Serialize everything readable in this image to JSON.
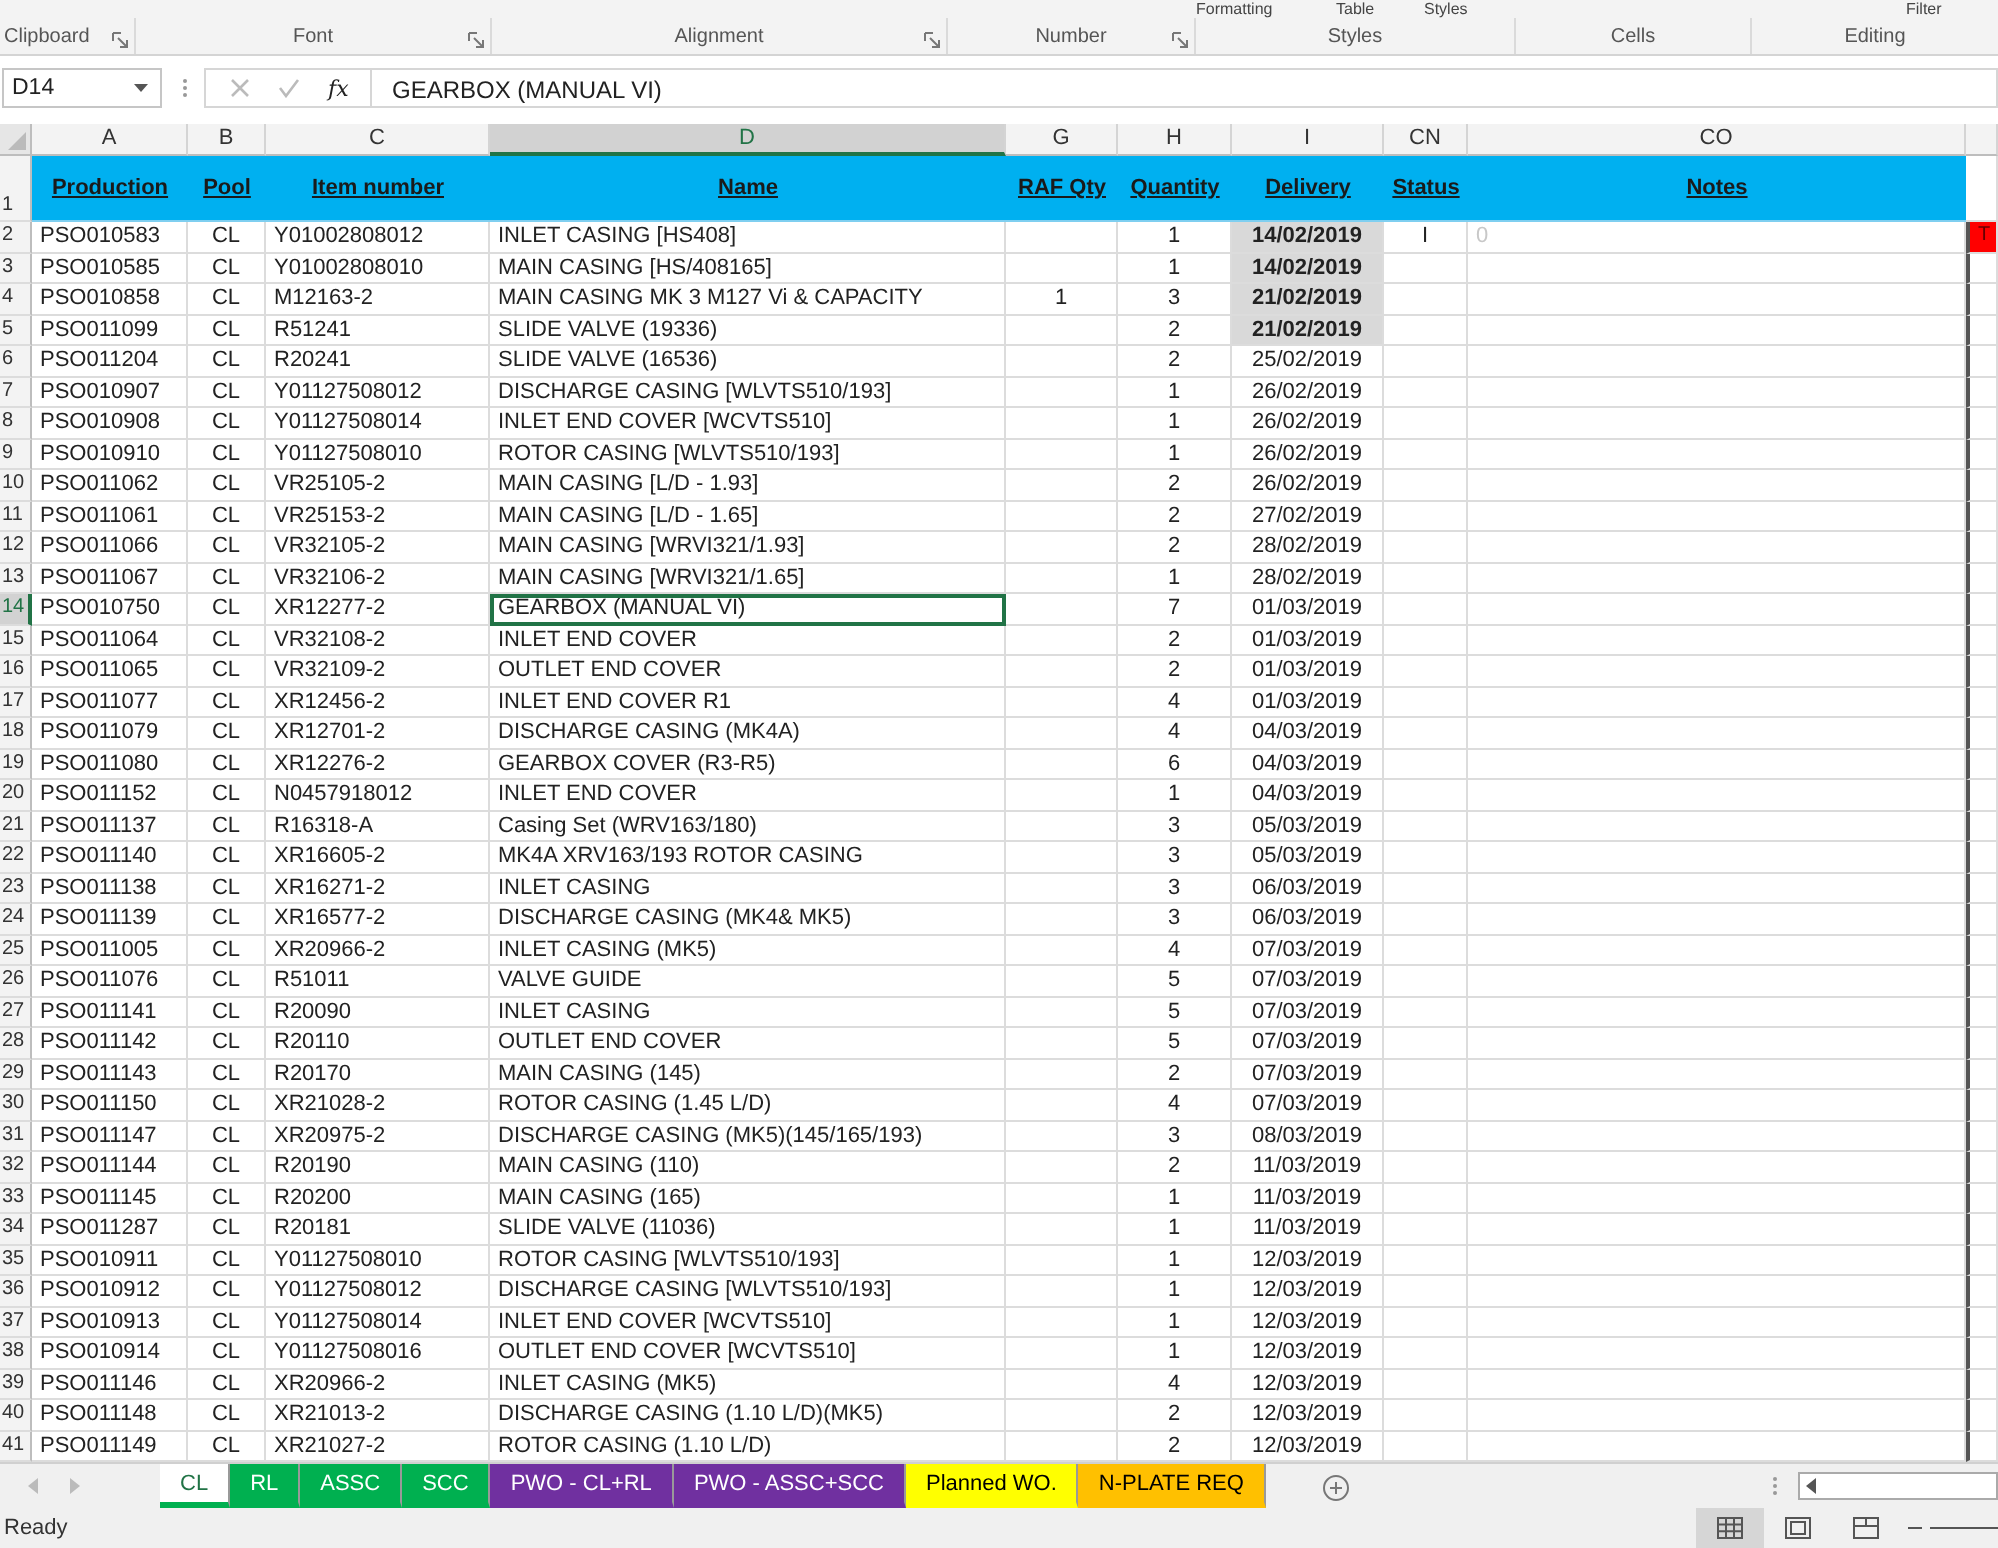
{
  "ribbon": {
    "cut_labels": [
      "Formatting",
      "Table",
      "Styles",
      "Filter"
    ],
    "groups": [
      {
        "label": "Clipboard",
        "launcher": true
      },
      {
        "label": "Font",
        "launcher": true
      },
      {
        "label": "Alignment",
        "launcher": true
      },
      {
        "label": "Number",
        "launcher": true
      },
      {
        "label": "Styles",
        "launcher": false
      },
      {
        "label": "Cells",
        "launcher": false
      },
      {
        "label": "Editing",
        "launcher": false
      }
    ]
  },
  "formula_bar": {
    "name_box": "D14",
    "function_label": "fx",
    "formula": "GEARBOX (MANUAL VI)"
  },
  "column_headers": [
    {
      "label": "A",
      "selected": false
    },
    {
      "label": "B",
      "selected": false
    },
    {
      "label": "C",
      "selected": false
    },
    {
      "label": "D",
      "selected": true
    },
    {
      "label": "G",
      "selected": false
    },
    {
      "label": "H",
      "selected": false
    },
    {
      "label": "I",
      "selected": false
    },
    {
      "label": "CN",
      "selected": false
    },
    {
      "label": "CO",
      "selected": false
    }
  ],
  "header_row": {
    "number": "1",
    "cells": [
      "Production",
      "Pool",
      "Item number",
      "Name",
      "RAF Qty",
      "Quantity",
      "Delivery",
      "Status",
      "Notes"
    ]
  },
  "rows": [
    {
      "number": "2",
      "active": false,
      "cells": [
        "PSO010583",
        "CL",
        "Y01002808012",
        "INLET CASING [HS408]",
        "",
        "1",
        "14/02/2019",
        "I",
        "0",
        "T"
      ],
      "delivery_highlight": true
    },
    {
      "number": "3",
      "active": false,
      "cells": [
        "PSO010585",
        "CL",
        "Y01002808010",
        "MAIN CASING [HS/408165]",
        "",
        "1",
        "14/02/2019",
        "",
        "",
        ""
      ],
      "delivery_highlight": true
    },
    {
      "number": "4",
      "active": false,
      "cells": [
        "PSO010858",
        "CL",
        "M12163-2",
        "MAIN CASING  MK 3 M127 Vi & CAPACITY",
        "1",
        "3",
        "21/02/2019",
        "",
        "",
        ""
      ],
      "delivery_highlight": true
    },
    {
      "number": "5",
      "active": false,
      "cells": [
        "PSO011099",
        "CL",
        "R51241",
        "SLIDE VALVE (19336)",
        "",
        "2",
        "21/02/2019",
        "",
        "",
        ""
      ],
      "delivery_highlight": true
    },
    {
      "number": "6",
      "active": false,
      "cells": [
        "PSO011204",
        "CL",
        "R20241",
        "SLIDE VALVE (16536)",
        "",
        "2",
        "25/02/2019",
        "",
        "",
        ""
      ],
      "delivery_highlight": false
    },
    {
      "number": "7",
      "active": false,
      "cells": [
        "PSO010907",
        "CL",
        "Y01127508012",
        "DISCHARGE CASING [WLVTS510/193]",
        "",
        "1",
        "26/02/2019",
        "",
        "",
        ""
      ],
      "delivery_highlight": false
    },
    {
      "number": "8",
      "active": false,
      "cells": [
        "PSO010908",
        "CL",
        "Y01127508014",
        "INLET END COVER [WCVTS510]",
        "",
        "1",
        "26/02/2019",
        "",
        "",
        ""
      ],
      "delivery_highlight": false
    },
    {
      "number": "9",
      "active": false,
      "cells": [
        "PSO010910",
        "CL",
        "Y01127508010",
        "ROTOR CASING [WLVTS510/193]",
        "",
        "1",
        "26/02/2019",
        "",
        "",
        ""
      ],
      "delivery_highlight": false
    },
    {
      "number": "10",
      "active": false,
      "cells": [
        "PSO011062",
        "CL",
        "VR25105-2",
        "MAIN CASING [L/D - 1.93]",
        "",
        "2",
        "26/02/2019",
        "",
        "",
        ""
      ],
      "delivery_highlight": false
    },
    {
      "number": "11",
      "active": false,
      "cells": [
        "PSO011061",
        "CL",
        "VR25153-2",
        "MAIN CASING [L/D - 1.65]",
        "",
        "2",
        "27/02/2019",
        "",
        "",
        ""
      ],
      "delivery_highlight": false
    },
    {
      "number": "12",
      "active": false,
      "cells": [
        "PSO011066",
        "CL",
        "VR32105-2",
        "MAIN CASING [WRVI321/1.93]",
        "",
        "2",
        "28/02/2019",
        "",
        "",
        ""
      ],
      "delivery_highlight": false
    },
    {
      "number": "13",
      "active": false,
      "cells": [
        "PSO011067",
        "CL",
        "VR32106-2",
        "MAIN CASING [WRVI321/1.65]",
        "",
        "1",
        "28/02/2019",
        "",
        "",
        ""
      ],
      "delivery_highlight": false
    },
    {
      "number": "14",
      "active": true,
      "cells": [
        "PSO010750",
        "CL",
        "XR12277-2",
        "GEARBOX (MANUAL VI)",
        "",
        "7",
        "01/03/2019",
        "",
        "",
        ""
      ],
      "delivery_highlight": false
    },
    {
      "number": "15",
      "active": false,
      "cells": [
        "PSO011064",
        "CL",
        "VR32108-2",
        "INLET END COVER",
        "",
        "2",
        "01/03/2019",
        "",
        "",
        ""
      ],
      "delivery_highlight": false
    },
    {
      "number": "16",
      "active": false,
      "cells": [
        "PSO011065",
        "CL",
        "VR32109-2",
        "OUTLET END COVER",
        "",
        "2",
        "01/03/2019",
        "",
        "",
        ""
      ],
      "delivery_highlight": false
    },
    {
      "number": "17",
      "active": false,
      "cells": [
        "PSO011077",
        "CL",
        "XR12456-2",
        "INLET END COVER  R1",
        "",
        "4",
        "01/03/2019",
        "",
        "",
        ""
      ],
      "delivery_highlight": false
    },
    {
      "number": "18",
      "active": false,
      "cells": [
        "PSO011079",
        "CL",
        "XR12701-2",
        "DISCHARGE CASING (MK4A)",
        "",
        "4",
        "04/03/2019",
        "",
        "",
        ""
      ],
      "delivery_highlight": false
    },
    {
      "number": "19",
      "active": false,
      "cells": [
        "PSO011080",
        "CL",
        "XR12276-2",
        "GEARBOX COVER (R3-R5)",
        "",
        "6",
        "04/03/2019",
        "",
        "",
        ""
      ],
      "delivery_highlight": false
    },
    {
      "number": "20",
      "active": false,
      "cells": [
        "PSO011152",
        "CL",
        "N0457918012",
        "INLET END COVER",
        "",
        "1",
        "04/03/2019",
        "",
        "",
        ""
      ],
      "delivery_highlight": false
    },
    {
      "number": "21",
      "active": false,
      "cells": [
        "PSO011137",
        "CL",
        "R16318-A",
        "Casing Set (WRV163/180)",
        "",
        "3",
        "05/03/2019",
        "",
        "",
        ""
      ],
      "delivery_highlight": false
    },
    {
      "number": "22",
      "active": false,
      "cells": [
        "PSO011140",
        "CL",
        "XR16605-2",
        "MK4A XRV163/193 ROTOR CASING",
        "",
        "3",
        "05/03/2019",
        "",
        "",
        ""
      ],
      "delivery_highlight": false
    },
    {
      "number": "23",
      "active": false,
      "cells": [
        "PSO011138",
        "CL",
        "XR16271-2",
        "INLET CASING",
        "",
        "3",
        "06/03/2019",
        "",
        "",
        ""
      ],
      "delivery_highlight": false
    },
    {
      "number": "24",
      "active": false,
      "cells": [
        "PSO011139",
        "CL",
        "XR16577-2",
        "DISCHARGE CASING (MK4& MK5)",
        "",
        "3",
        "06/03/2019",
        "",
        "",
        ""
      ],
      "delivery_highlight": false
    },
    {
      "number": "25",
      "active": false,
      "cells": [
        "PSO011005",
        "CL",
        "XR20966-2",
        "INLET CASING (MK5)",
        "",
        "4",
        "07/03/2019",
        "",
        "",
        ""
      ],
      "delivery_highlight": false
    },
    {
      "number": "26",
      "active": false,
      "cells": [
        "PSO011076",
        "CL",
        "R51011",
        "VALVE GUIDE",
        "",
        "5",
        "07/03/2019",
        "",
        "",
        ""
      ],
      "delivery_highlight": false
    },
    {
      "number": "27",
      "active": false,
      "cells": [
        "PSO011141",
        "CL",
        "R20090",
        "INLET CASING",
        "",
        "5",
        "07/03/2019",
        "",
        "",
        ""
      ],
      "delivery_highlight": false
    },
    {
      "number": "28",
      "active": false,
      "cells": [
        "PSO011142",
        "CL",
        "R20110",
        "OUTLET END COVER",
        "",
        "5",
        "07/03/2019",
        "",
        "",
        ""
      ],
      "delivery_highlight": false
    },
    {
      "number": "29",
      "active": false,
      "cells": [
        "PSO011143",
        "CL",
        "R20170",
        "MAIN CASING (145)",
        "",
        "2",
        "07/03/2019",
        "",
        "",
        ""
      ],
      "delivery_highlight": false
    },
    {
      "number": "30",
      "active": false,
      "cells": [
        "PSO011150",
        "CL",
        "XR21028-2",
        "ROTOR CASING (1.45 L/D)",
        "",
        "4",
        "07/03/2019",
        "",
        "",
        ""
      ],
      "delivery_highlight": false
    },
    {
      "number": "31",
      "active": false,
      "cells": [
        "PSO011147",
        "CL",
        "XR20975-2",
        "DISCHARGE CASING (MK5)(145/165/193)",
        "",
        "3",
        "08/03/2019",
        "",
        "",
        ""
      ],
      "delivery_highlight": false
    },
    {
      "number": "32",
      "active": false,
      "cells": [
        "PSO011144",
        "CL",
        "R20190",
        "MAIN CASING (110)",
        "",
        "2",
        "11/03/2019",
        "",
        "",
        ""
      ],
      "delivery_highlight": false
    },
    {
      "number": "33",
      "active": false,
      "cells": [
        "PSO011145",
        "CL",
        "R20200",
        "MAIN CASING (165)",
        "",
        "1",
        "11/03/2019",
        "",
        "",
        ""
      ],
      "delivery_highlight": false
    },
    {
      "number": "34",
      "active": false,
      "cells": [
        "PSO011287",
        "CL",
        "R20181",
        "SLIDE VALVE (11036)",
        "",
        "1",
        "11/03/2019",
        "",
        "",
        ""
      ],
      "delivery_highlight": false
    },
    {
      "number": "35",
      "active": false,
      "cells": [
        "PSO010911",
        "CL",
        "Y01127508010",
        "ROTOR CASING [WLVTS510/193]",
        "",
        "1",
        "12/03/2019",
        "",
        "",
        ""
      ],
      "delivery_highlight": false
    },
    {
      "number": "36",
      "active": false,
      "cells": [
        "PSO010912",
        "CL",
        "Y01127508012",
        "DISCHARGE CASING [WLVTS510/193]",
        "",
        "1",
        "12/03/2019",
        "",
        "",
        ""
      ],
      "delivery_highlight": false
    },
    {
      "number": "37",
      "active": false,
      "cells": [
        "PSO010913",
        "CL",
        "Y01127508014",
        "INLET END COVER [WCVTS510]",
        "",
        "1",
        "12/03/2019",
        "",
        "",
        ""
      ],
      "delivery_highlight": false
    },
    {
      "number": "38",
      "active": false,
      "cells": [
        "PSO010914",
        "CL",
        "Y01127508016",
        "OUTLET END COVER [WCVTS510]",
        "",
        "1",
        "12/03/2019",
        "",
        "",
        ""
      ],
      "delivery_highlight": false
    },
    {
      "number": "39",
      "active": false,
      "cells": [
        "PSO011146",
        "CL",
        "XR20966-2",
        "INLET CASING (MK5)",
        "",
        "4",
        "12/03/2019",
        "",
        "",
        ""
      ],
      "delivery_highlight": false
    },
    {
      "number": "40",
      "active": false,
      "cells": [
        "PSO011148",
        "CL",
        "XR21013-2",
        "DISCHARGE CASING (1.10 L/D)(MK5)",
        "",
        "2",
        "12/03/2019",
        "",
        "",
        ""
      ],
      "delivery_highlight": false
    },
    {
      "number": "41",
      "active": false,
      "cells": [
        "PSO011149",
        "CL",
        "XR21027-2",
        "ROTOR CASING (1.10 L/D)",
        "",
        "2",
        "12/03/2019",
        "",
        "",
        ""
      ],
      "delivery_highlight": false
    }
  ],
  "sheet_tabs": [
    {
      "label": "CL",
      "selected": true,
      "color": "#00b050"
    },
    {
      "label": "RL",
      "selected": false,
      "color": "#00b050"
    },
    {
      "label": "ASSC",
      "selected": false,
      "color": "#00b050"
    },
    {
      "label": "SCC",
      "selected": false,
      "color": "#00b050"
    },
    {
      "label": "PWO - CL+RL",
      "selected": false,
      "color": "#7030a0"
    },
    {
      "label": "PWO - ASSC+SCC",
      "selected": false,
      "color": "#7030a0"
    },
    {
      "label": "Planned WO.",
      "selected": false,
      "color": "#ffff00"
    },
    {
      "label": "N-PLATE REQ",
      "selected": false,
      "color": "#ffc000"
    }
  ],
  "status_bar": {
    "status": "Ready"
  }
}
